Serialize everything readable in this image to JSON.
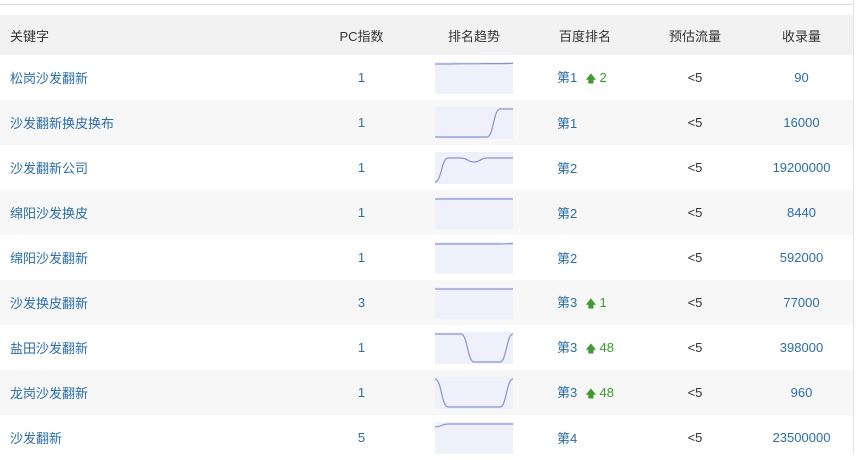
{
  "headers": {
    "keyword": "关键字",
    "pc_index": "PC指数",
    "trend": "排名趋势",
    "baidu_rank": "百度排名",
    "traffic": "预估流量",
    "indexed": "收录量"
  },
  "rows": [
    {
      "keyword": "松岗沙发翻新",
      "pc_index": "1",
      "rank": "第1",
      "change": "2",
      "traffic": "<5",
      "indexed": "90",
      "trend": [
        2,
        2,
        1.8,
        1.8,
        1.6,
        1.6,
        1.4
      ]
    },
    {
      "keyword": "沙发翻新换皮换布",
      "pc_index": "1",
      "rank": "第1",
      "change": "",
      "traffic": "<5",
      "indexed": "16000",
      "trend": [
        30,
        30,
        30,
        30,
        30,
        2,
        2
      ]
    },
    {
      "keyword": "沙发翻新公司",
      "pc_index": "1",
      "rank": "第2",
      "change": "",
      "traffic": "<5",
      "indexed": "19200000",
      "trend": [
        30,
        6,
        6,
        10,
        6,
        6,
        6
      ]
    },
    {
      "keyword": "绵阳沙发换皮",
      "pc_index": "1",
      "rank": "第2",
      "change": "",
      "traffic": "<5",
      "indexed": "8440",
      "trend": [
        2,
        2,
        2,
        2,
        2,
        2,
        2
      ]
    },
    {
      "keyword": "绵阳沙发翻新",
      "pc_index": "1",
      "rank": "第2",
      "change": "",
      "traffic": "<5",
      "indexed": "592000",
      "trend": [
        2,
        2,
        2,
        2,
        2,
        2,
        1.6
      ]
    },
    {
      "keyword": "沙发换皮翻新",
      "pc_index": "3",
      "rank": "第3",
      "change": "1",
      "traffic": "<5",
      "indexed": "77000",
      "trend": [
        2,
        2,
        2,
        2,
        2,
        2,
        2
      ]
    },
    {
      "keyword": "盐田沙发翻新",
      "pc_index": "1",
      "rank": "第3",
      "change": "48",
      "traffic": "<5",
      "indexed": "398000",
      "trend": [
        2,
        2,
        2,
        30,
        30,
        30,
        2
      ]
    },
    {
      "keyword": "龙岗沙发翻新",
      "pc_index": "1",
      "rank": "第3",
      "change": "48",
      "traffic": "<5",
      "indexed": "960",
      "trend": [
        2,
        30,
        30,
        30,
        30,
        30,
        2
      ]
    },
    {
      "keyword": "沙发翻新",
      "pc_index": "5",
      "rank": "第4",
      "change": "",
      "traffic": "<5",
      "indexed": "23500000",
      "trend": [
        5,
        2,
        2,
        2,
        2,
        2,
        2
      ]
    }
  ],
  "colors": {
    "link": "#2a6ea8",
    "up": "#3f9a2f",
    "spark_line": "#8a93cf",
    "spark_fill": "#eef0fa"
  }
}
